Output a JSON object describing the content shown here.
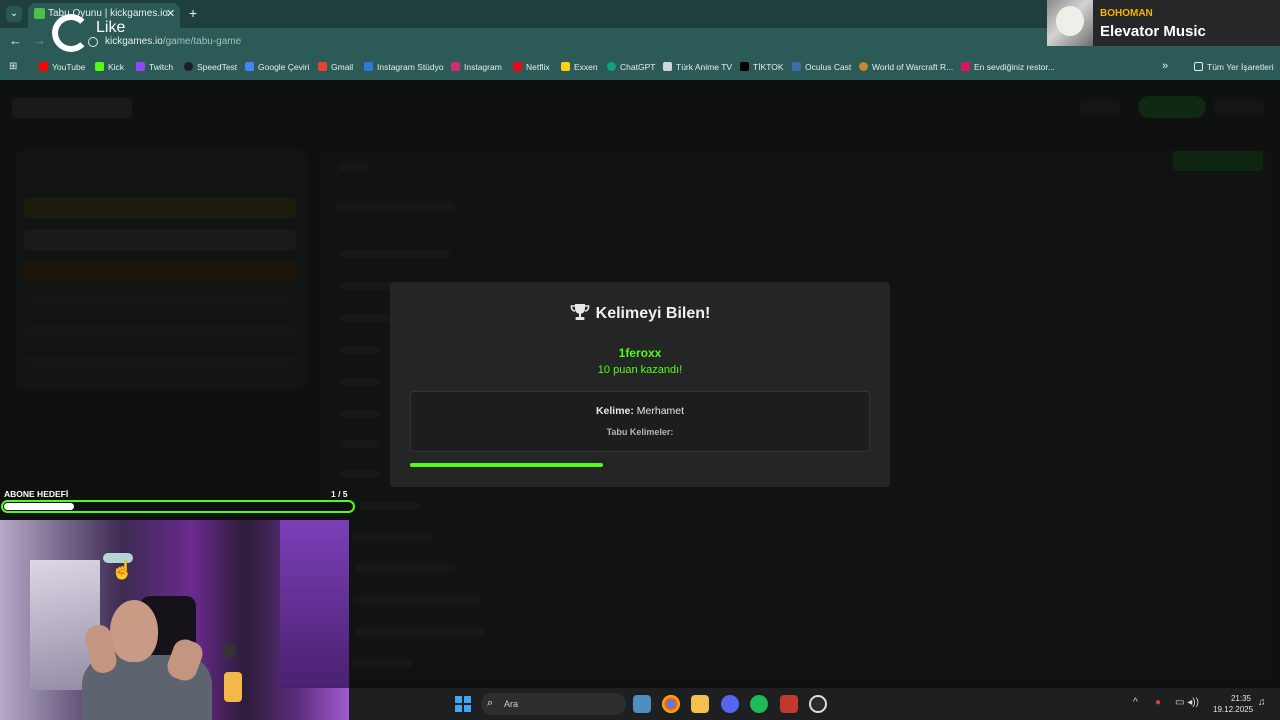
{
  "browser": {
    "tab_title": "Tabu Oyunu | kickgames.io",
    "url_host": "kickgames.io",
    "url_path": "/game/tabu-game",
    "bookmarks": [
      "YouTube",
      "Kick",
      "Twitch",
      "SpeedTest",
      "Google Çeviri",
      "Gmail",
      "Instagram Stüdyo",
      "Instagram",
      "Netflix",
      "Exxen",
      "ChatGPT",
      "Türk Anime TV",
      "TİKTOK",
      "Oculus Cast",
      "World of Warcraft R...",
      "En sevdiğiniz restor..."
    ],
    "bookmarks_folder": "Tüm Yer İşaretleri"
  },
  "overlay": {
    "like_label": "Like",
    "music_artist": "BOHOMAN",
    "music_title": "Elevator Music",
    "goal_label": "ABONE HEDEFİ",
    "goal_count": "1 / 5",
    "goal_progress": 0.2
  },
  "modal": {
    "title": "Kelimeyi Bilen!",
    "winner": "1feroxx",
    "points_text": "10 puan kazandı!",
    "word_label": "Kelime:",
    "word": "Merhamet",
    "taboo_label": "Tabu Kelimeler:",
    "timer_progress": 0.42
  },
  "taskbar": {
    "search_placeholder": "Ara",
    "time": "21:35",
    "date": "19.12.2025"
  },
  "colors": {
    "accent_green": "#53fc18",
    "chrome_teal": "#2c5a57"
  }
}
